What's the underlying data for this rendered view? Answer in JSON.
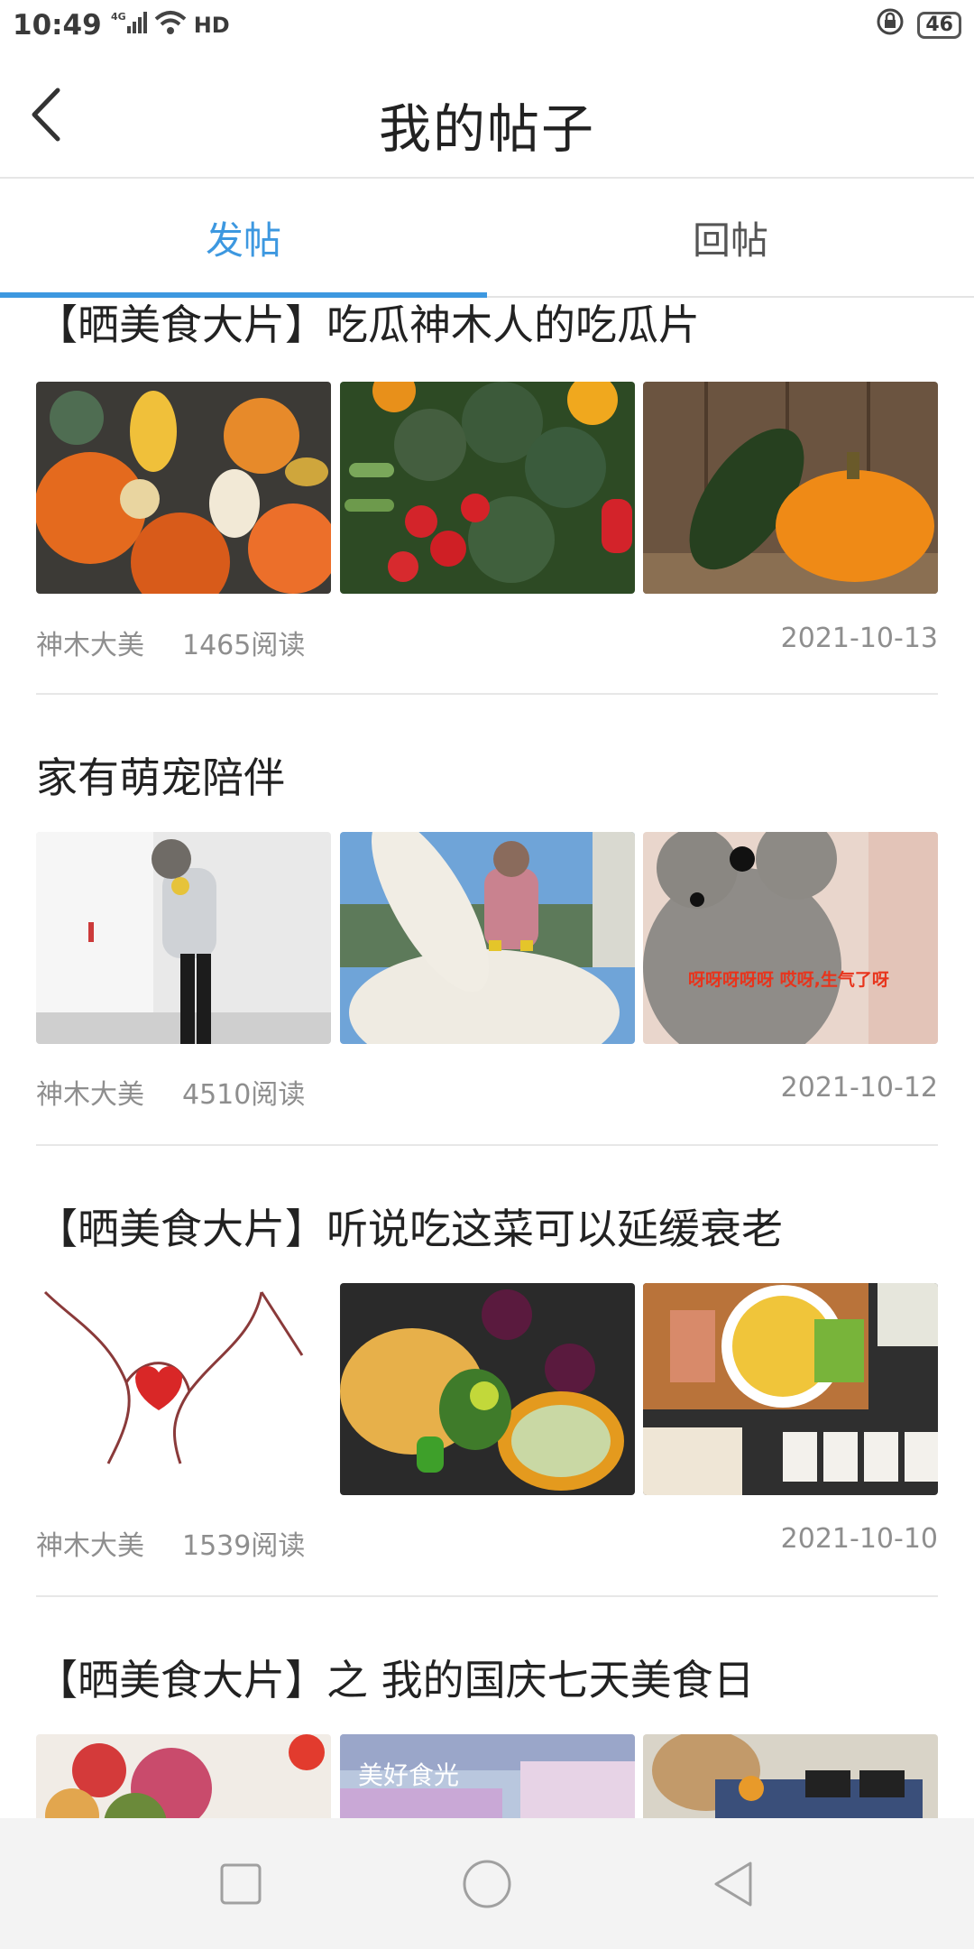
{
  "status_bar": {
    "time": "10:49",
    "network": "4G",
    "hd": "HD",
    "battery": "46"
  },
  "header": {
    "title": "我的帖子"
  },
  "tabs": [
    {
      "label": "发帖",
      "active": true
    },
    {
      "label": "回帖",
      "active": false
    }
  ],
  "posts": [
    {
      "title": "【晒美食大片】吃瓜神木人的吃瓜片",
      "author": "神木大美",
      "reads": "1465阅读",
      "date": "2021-10-13",
      "images": [
        "pumpkins-photo",
        "vegetables-photo",
        "squash-pumpkin-photo"
      ]
    },
    {
      "title": "家有萌宠陪伴",
      "author": "神木大美",
      "reads": "4510阅读",
      "date": "2021-10-12",
      "images": [
        "person-holding-dog-photo",
        "dog-on-sculpture-photo",
        "poodle-photo"
      ],
      "image_caption": "呀呀呀呀呀 哎呀,生气了呀"
    },
    {
      "title": "【晒美食大片】听说吃这菜可以延缓衰老",
      "author": "神木大美",
      "reads": "1539阅读",
      "date": "2021-10-10",
      "images": [
        "heart-hands-drawing",
        "vegetable-basket-photo",
        "cutting-board-dishes-photo"
      ]
    },
    {
      "title": "【晒美食大片】之 我的国庆七天美食日",
      "images": [
        "fruit-bowls-photo",
        "food-poster-photo",
        "bread-tray-photo"
      ],
      "image_caption": "美好食光"
    }
  ],
  "colors": {
    "accent": "#3d98e0",
    "text": "#222222",
    "meta": "#8e8e8e",
    "nav_bg": "#f3f3f3"
  },
  "nav_bar": [
    "recents-button",
    "home-button",
    "back-button"
  ]
}
